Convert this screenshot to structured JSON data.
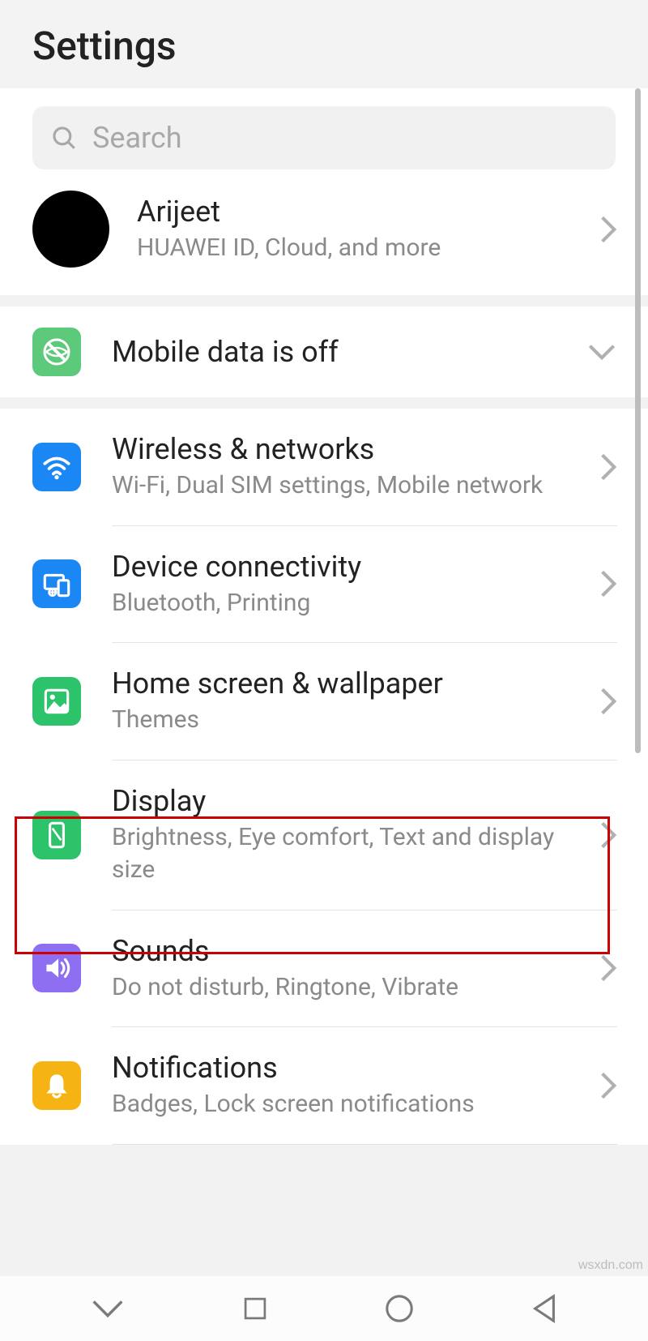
{
  "header": {
    "title": "Settings"
  },
  "search": {
    "placeholder": "Search"
  },
  "account": {
    "name": "Arijeet",
    "subtitle": "HUAWEI ID, Cloud, and more"
  },
  "mobile_data": {
    "label": "Mobile data is off"
  },
  "items": [
    {
      "title": "Wireless & networks",
      "subtitle": "Wi-Fi, Dual SIM settings, Mobile network",
      "icon": "wifi",
      "color": "#1a87f5"
    },
    {
      "title": "Device connectivity",
      "subtitle": "Bluetooth, Printing",
      "icon": "devices",
      "color": "#1a87f5"
    },
    {
      "title": "Home screen & wallpaper",
      "subtitle": "Themes",
      "icon": "image",
      "color": "#2cc36b"
    },
    {
      "title": "Display",
      "subtitle": "Brightness, Eye comfort, Text and display size",
      "icon": "display",
      "color": "#2cc36b"
    },
    {
      "title": "Sounds",
      "subtitle": "Do not disturb, Ringtone, Vibrate",
      "icon": "sound",
      "color": "#8e6ff2"
    },
    {
      "title": "Notifications",
      "subtitle": "Badges, Lock screen notifications",
      "icon": "bell",
      "color": "#f5b314"
    }
  ],
  "watermark": "wsxdn.com"
}
